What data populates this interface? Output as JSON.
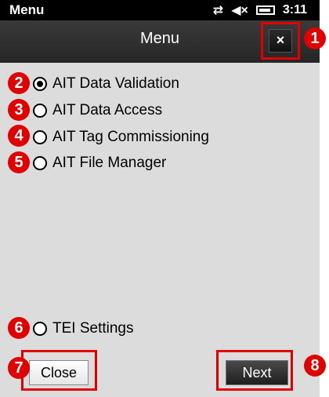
{
  "statusbar": {
    "title": "Menu",
    "time": "3:11"
  },
  "header": {
    "title": "Menu",
    "close_icon": "×"
  },
  "options": [
    {
      "label": "AIT Data Validation",
      "checked": true
    },
    {
      "label": "AIT Data Access",
      "checked": false
    },
    {
      "label": "AIT Tag Commissioning",
      "checked": false
    },
    {
      "label": "AIT File Manager",
      "checked": false
    }
  ],
  "settings_option": {
    "label": "TEI Settings",
    "checked": false
  },
  "buttons": {
    "close": "Close",
    "next": "Next"
  },
  "badges": [
    "1",
    "2",
    "3",
    "4",
    "5",
    "6",
    "7",
    "8"
  ],
  "colors": {
    "annotation": "#e00000",
    "background": "#dcdcdc",
    "header": "#2a2a2a"
  }
}
